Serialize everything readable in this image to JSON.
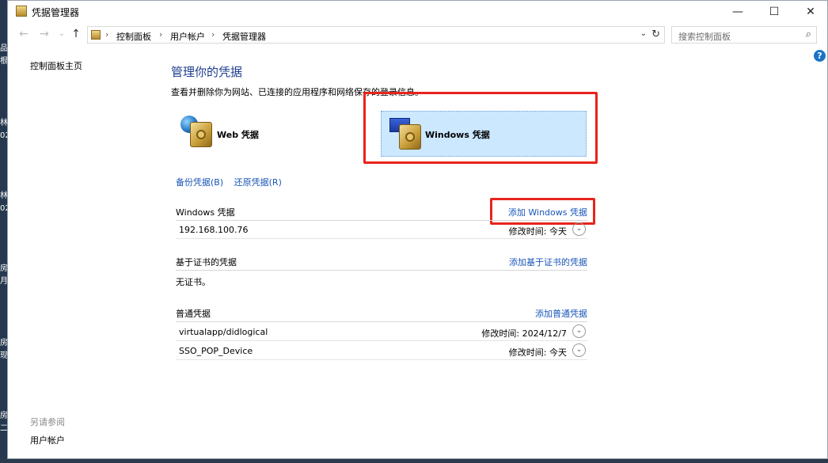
{
  "window": {
    "title": "凭据管理器",
    "minimize_label": "—",
    "maximize_label": "☐",
    "close_label": "✕"
  },
  "nav": {
    "back": "←",
    "forward": "→",
    "down": "⌄",
    "up": "↑"
  },
  "address": {
    "breadcrumbs": [
      "控制面板",
      "用户帐户",
      "凭据管理器"
    ],
    "separator": "›",
    "dropdown": "⌄",
    "refresh": "↻"
  },
  "search": {
    "placeholder": "搜索控制面板",
    "icon": "search-icon"
  },
  "help": {
    "label": "?"
  },
  "sidebar": {
    "home": "控制面板主页",
    "see_also": "另请参阅",
    "user_accounts": "用户帐户"
  },
  "main": {
    "title": "管理你的凭据",
    "description": "查看并删除你为网站、已连接的应用程序和网络保存的登录信息。",
    "web_tile": {
      "label": "Web 凭据",
      "icon": "web-vault-icon"
    },
    "windows_tile": {
      "label": "Windows 凭据",
      "icon": "windows-vault-icon"
    },
    "backup_link": "备份凭据(B)",
    "restore_link": "还原凭据(R)"
  },
  "windows_creds": {
    "heading": "Windows 凭据",
    "add_link": "添加 Windows 凭据",
    "items": [
      {
        "name": "192.168.100.76",
        "meta": "修改时间: 今天"
      }
    ]
  },
  "cert_creds": {
    "heading": "基于证书的凭据",
    "add_link": "添加基于证书的凭据",
    "empty_text": "无证书。"
  },
  "generic_creds": {
    "heading": "普通凭据",
    "add_link": "添加普通凭据",
    "items": [
      {
        "name": "virtualapp/didlogical",
        "meta": "修改时间: 2024/12/7"
      },
      {
        "name": "SSO_POP_Device",
        "meta": "修改时间: 今天"
      }
    ]
  },
  "expand_glyph": "⌄",
  "desktop_fragments": [
    "品",
    "根",
    "林",
    "02",
    "林",
    "02",
    "房",
    "月",
    "房",
    "现",
    "房",
    "二"
  ],
  "colors": {
    "accent": "#1a56b8",
    "highlight": "#e8241c",
    "selected_tile": "#cce8ff",
    "title_blue": "#1e3d8f"
  }
}
